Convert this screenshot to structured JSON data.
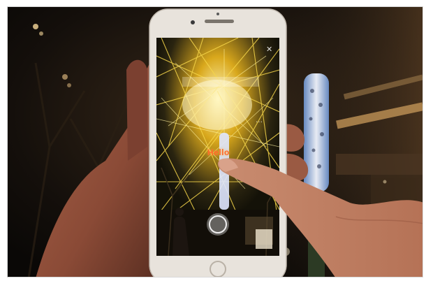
{
  "scene": {
    "description_icon": "photo-icon",
    "screen_text": "Hello",
    "colors": {
      "night_bg": "#120f0c",
      "lights": "#f2c94c",
      "glow": "#fff2a8",
      "skin": "#c9876b",
      "phone_body": "#e8e3dc",
      "text_orange": "#ff6a2a"
    }
  }
}
